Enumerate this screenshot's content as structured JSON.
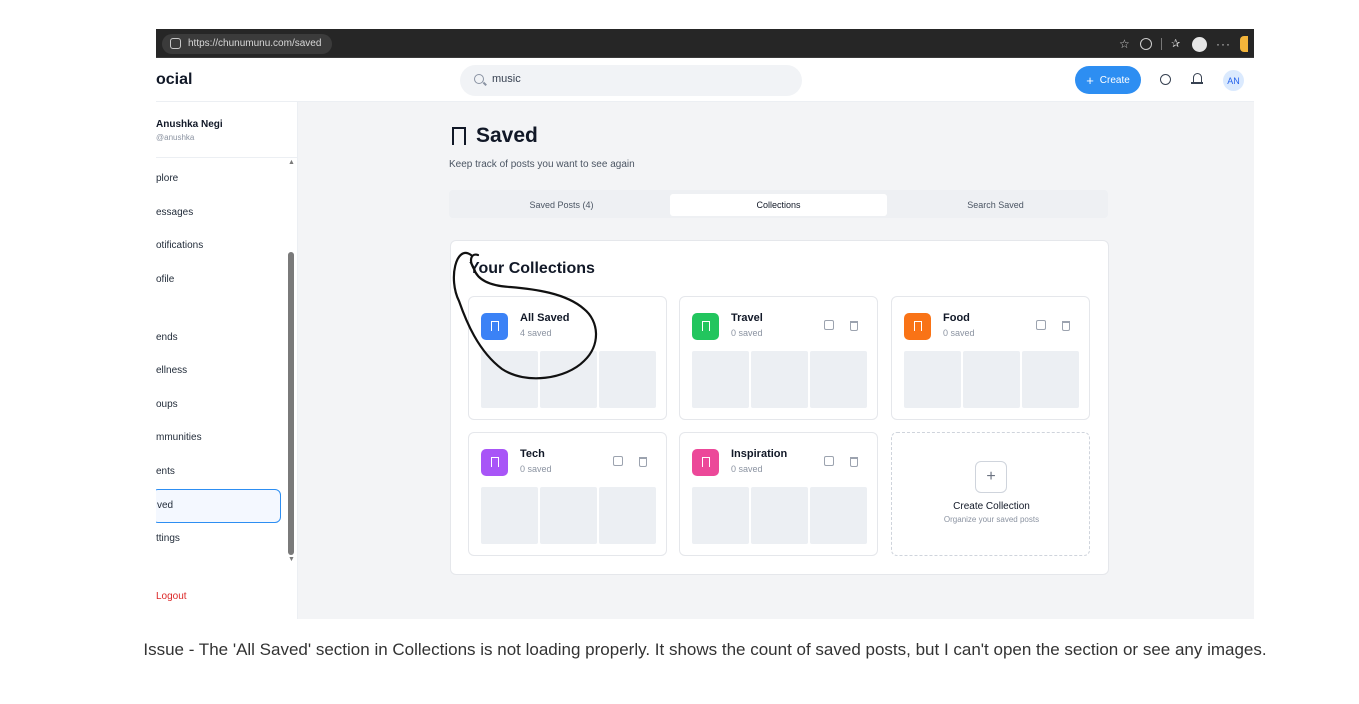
{
  "browser": {
    "url": "https://chunumunu.com/saved"
  },
  "app": {
    "brand": "ocial",
    "search_value": "music",
    "create_label": "Create",
    "avatar_initials": "AN"
  },
  "sidebar": {
    "user_name": "Anushka Negi",
    "user_handle": "@anushka",
    "items": [
      {
        "label": "plore"
      },
      {
        "label": "essages"
      },
      {
        "label": "otifications"
      },
      {
        "label": "ofile"
      },
      {
        "label": "ends"
      },
      {
        "label": "ellness"
      },
      {
        "label": "oups"
      },
      {
        "label": "mmunities"
      },
      {
        "label": "ents"
      },
      {
        "label": "ved"
      },
      {
        "label": "ttings"
      }
    ],
    "logout_label": "Logout"
  },
  "page": {
    "title": "Saved",
    "subtitle": "Keep track of posts you want to see again",
    "tabs": [
      {
        "label": "Saved Posts (4)"
      },
      {
        "label": "Collections"
      },
      {
        "label": "Search Saved"
      }
    ]
  },
  "collections": {
    "heading": "Your Collections",
    "items": [
      {
        "name": "All Saved",
        "count": "4 saved",
        "color": "#3b82f6"
      },
      {
        "name": "Travel",
        "count": "0 saved",
        "color": "#22c55e"
      },
      {
        "name": "Food",
        "count": "0 saved",
        "color": "#f97316"
      },
      {
        "name": "Tech",
        "count": "0 saved",
        "color": "#a855f7"
      },
      {
        "name": "Inspiration",
        "count": "0 saved",
        "color": "#ec4899"
      }
    ],
    "create_title": "Create Collection",
    "create_subtitle": "Organize your saved posts"
  },
  "caption": "Issue - The 'All Saved' section in Collections is not loading properly. It shows the count of saved posts, but I can't open the section or see any images."
}
